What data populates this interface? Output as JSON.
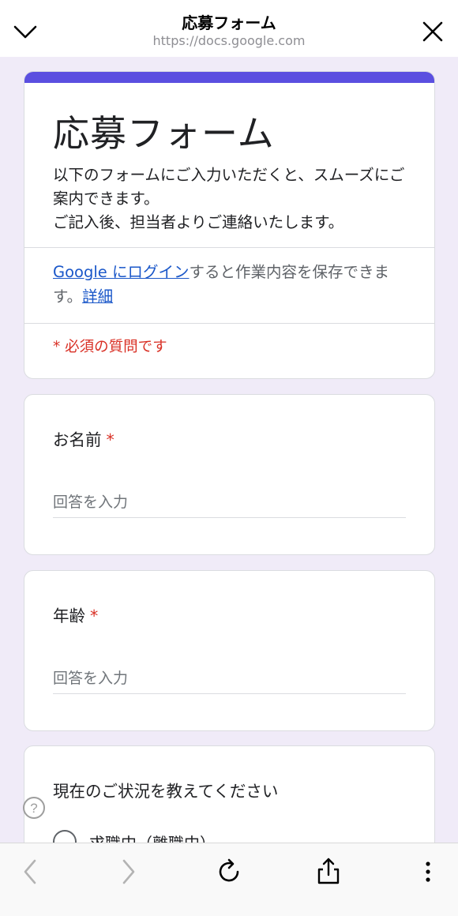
{
  "browser": {
    "title": "応募フォーム",
    "url": "https://docs.google.com"
  },
  "form": {
    "title": "応募フォーム",
    "description_line1": "以下のフォームにご入力いただくと、スムーズにご案内できます。",
    "description_line2": "ご記入後、担当者よりご連絡いたします。",
    "login_link": "Google にログイン",
    "login_text": "すると作業内容を保存できます。",
    "details_link": "詳細",
    "required_note": "* 必須の質問です",
    "accent_color": "#5b4fe0"
  },
  "questions": [
    {
      "label": "お名前",
      "required_mark": "*",
      "placeholder": "回答を入力"
    },
    {
      "label": "年齢",
      "required_mark": "*",
      "placeholder": "回答を入力"
    },
    {
      "label": "現在のご状況を教えてください",
      "first_option": "求職中（離職中）"
    }
  ],
  "icons": {
    "top_left": "chevron-down-icon",
    "top_right": "close-icon",
    "help": "help-circle-icon",
    "back": "chevron-left-icon",
    "forward": "chevron-right-icon",
    "reload": "reload-icon",
    "share": "share-icon",
    "more": "more-vertical-icon"
  }
}
